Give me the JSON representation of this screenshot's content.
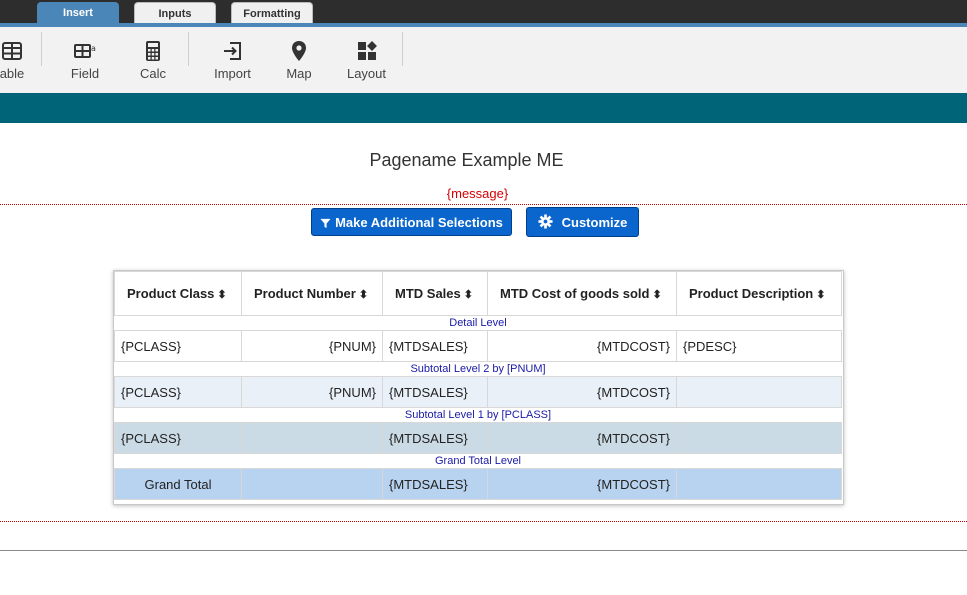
{
  "tabs": [
    {
      "label": "Insert",
      "active": true
    },
    {
      "label": "Inputs",
      "active": false
    },
    {
      "label": "Formatting",
      "active": false
    }
  ],
  "ribbon": {
    "items": [
      {
        "label": "able",
        "icon": "table-icon"
      },
      {
        "label": "Field",
        "icon": "field-icon"
      },
      {
        "label": "Calc",
        "icon": "calculator-icon"
      },
      {
        "label": "Import",
        "icon": "import-icon"
      },
      {
        "label": "Map",
        "icon": "map-marker-icon"
      },
      {
        "label": "Layout",
        "icon": "layout-icon"
      }
    ]
  },
  "page": {
    "title": "Pagename Example ME",
    "message": "{message}"
  },
  "buttons": {
    "selections": "Make Additional Selections",
    "customize": "Customize"
  },
  "grid": {
    "columns": [
      "Product Class",
      "Product Number",
      "MTD Sales",
      "MTD Cost of goods sold",
      "Product Description"
    ],
    "sort_glyph": "⬍",
    "levels": {
      "detail": "Detail Level",
      "sub2": "Subtotal Level 2 by [PNUM]",
      "sub1": "Subtotal Level 1 by [PCLASS]",
      "grand": "Grand Total Level"
    },
    "detail_row": [
      "{PCLASS}",
      "{PNUM}",
      "{MTDSALES}",
      "{MTDCOST}",
      "{PDESC}"
    ],
    "sub2_row": [
      "{PCLASS}",
      "{PNUM}",
      "{MTDSALES}",
      "{MTDCOST}",
      ""
    ],
    "sub1_row": [
      "{PCLASS}",
      "",
      "{MTDSALES}",
      "{MTDCOST}",
      ""
    ],
    "grand_row": [
      "Grand Total",
      "",
      "{MTDSALES}",
      "{MTDCOST}",
      ""
    ]
  },
  "colors": {
    "accent": "#4a86b8",
    "teal": "#006478",
    "button": "#0a66cc",
    "message": "#d40000"
  }
}
